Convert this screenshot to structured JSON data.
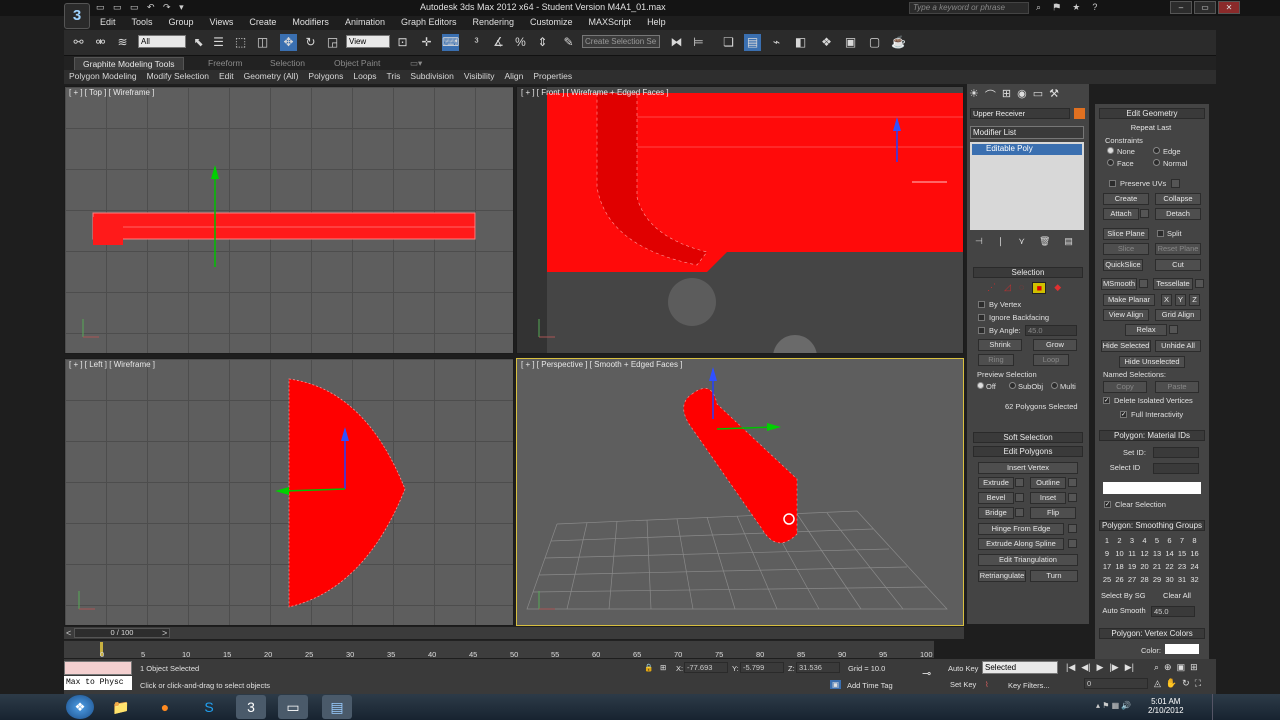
{
  "window": {
    "title": "Autodesk 3ds Max  2012 x64  - Student Version   M4A1_01.max",
    "search_placeholder": "Type a keyword or phrase",
    "logo": "3"
  },
  "menus": [
    "Edit",
    "Tools",
    "Group",
    "Views",
    "Create",
    "Modifiers",
    "Animation",
    "Graph Editors",
    "Rendering",
    "Customize",
    "MAXScript",
    "Help"
  ],
  "toolbar": {
    "selection_filter": "All",
    "reference_coord": "View",
    "named_selection": "Create Selection Se"
  },
  "ribbon": {
    "tabs": [
      "Graphite Modeling Tools",
      "Freeform",
      "Selection",
      "Object Paint"
    ],
    "panels": [
      "Polygon Modeling",
      "Modify Selection",
      "Edit",
      "Geometry (All)",
      "Polygons",
      "Loops",
      "Tris",
      "Subdivision",
      "Visibility",
      "Align",
      "Properties"
    ]
  },
  "viewports": {
    "top": {
      "label": "[ + ] [ Top ] [ Wireframe ]"
    },
    "front": {
      "label": "[ + ] [ Front ] [ Wireframe + Edged Faces ]"
    },
    "left": {
      "label": "[ + ] [ Left ] [ Wireframe ]"
    },
    "perspective": {
      "label": "[ + ] [ Perspective ] [ Smooth + Edged Faces ]"
    }
  },
  "modify_panel": {
    "object_name": "Upper Receiver",
    "object_color": "#e07020",
    "modifier_list": "Modifier List",
    "stack_item": "Editable Poly",
    "selection": {
      "header": "Selection",
      "by_vertex": "By Vertex",
      "ignore_backfacing": "Ignore Backfacing",
      "by_angle": "By Angle:",
      "angle_value": "45.0",
      "shrink": "Shrink",
      "grow": "Grow",
      "ring": "Ring",
      "loop": "Loop",
      "preview_selection": "Preview Selection",
      "off": "Off",
      "subobj": "SubObj",
      "multi": "Multi",
      "status": "62 Polygons Selected"
    },
    "soft_selection": "Soft Selection",
    "edit_polygons": {
      "header": "Edit Polygons",
      "insert_vertex": "Insert Vertex",
      "extrude": "Extrude",
      "outline": "Outline",
      "bevel": "Bevel",
      "inset": "Inset",
      "bridge": "Bridge",
      "flip": "Flip",
      "hinge": "Hinge From Edge",
      "extrude_spline": "Extrude Along Spline",
      "edit_tri": "Edit Triangulation",
      "retriangulate": "Retriangulate",
      "turn": "Turn"
    }
  },
  "edit_geometry": {
    "header": "Edit Geometry",
    "repeat_last": "Repeat Last",
    "constraints": "Constraints",
    "none": "None",
    "edge": "Edge",
    "face": "Face",
    "normal": "Normal",
    "preserve_uvs": "Preserve UVs",
    "create": "Create",
    "collapse": "Collapse",
    "attach": "Attach",
    "detach": "Detach",
    "slice_plane": "Slice Plane",
    "split": "Split",
    "slice": "Slice",
    "reset_plane": "Reset Plane",
    "quickslice": "QuickSlice",
    "cut": "Cut",
    "msmooth": "MSmooth",
    "tessellate": "Tessellate",
    "make_planar": "Make Planar",
    "x": "X",
    "y": "Y",
    "z": "Z",
    "view_align": "View Align",
    "grid_align": "Grid Align",
    "relax": "Relax",
    "hide_selected": "Hide Selected",
    "unhide_all": "Unhide All",
    "hide_unselected": "Hide Unselected",
    "named_selections": "Named Selections:",
    "copy": "Copy",
    "paste": "Paste",
    "delete_isolated": "Delete Isolated Vertices",
    "full_interactivity": "Full Interactivity",
    "material_header": "Polygon: Material IDs",
    "set_id": "Set ID:",
    "select_id": "Select ID",
    "clear_selection": "Clear Selection",
    "smoothing_header": "Polygon: Smoothing Groups",
    "groups": [
      "1",
      "2",
      "3",
      "4",
      "5",
      "6",
      "7",
      "8",
      "9",
      "10",
      "11",
      "12",
      "13",
      "14",
      "15",
      "16",
      "17",
      "18",
      "19",
      "20",
      "21",
      "22",
      "23",
      "24",
      "25",
      "26",
      "27",
      "28",
      "29",
      "30",
      "31",
      "32"
    ],
    "select_by_sg": "Select By SG",
    "clear_all": "Clear All",
    "auto_smooth": "Auto Smooth",
    "auto_smooth_value": "45.0",
    "vertex_colors_header": "Polygon: Vertex Colors",
    "color": "Color:"
  },
  "timeline": {
    "frame": "0 / 100",
    "ticks": [
      "0",
      "5",
      "10",
      "15",
      "20",
      "25",
      "30",
      "35",
      "40",
      "45",
      "50",
      "55",
      "60",
      "65",
      "70",
      "75",
      "80",
      "85",
      "90",
      "95",
      "100"
    ]
  },
  "status": {
    "maxscript": "Max to Physc",
    "selected": "1 Object Selected",
    "prompt": "Click or click-and-drag to select objects",
    "x_label": "X:",
    "x": "-77.693",
    "y_label": "Y:",
    "y": "-5.799",
    "z_label": "Z:",
    "z": "31.536",
    "grid": "Grid = 10.0",
    "add_time_tag": "Add Time Tag",
    "auto_key": "Auto Key",
    "set_key": "Set Key",
    "key_mode": "Selected",
    "key_filters": "Key Filters...",
    "frame_spinner": "0"
  },
  "taskbar": {
    "time": "5:01 AM",
    "date": "2/10/2012"
  },
  "colors": {
    "mesh": "#ff0000",
    "viewport_bg": "#5e5e5e",
    "accent": "#3a6fb0"
  }
}
